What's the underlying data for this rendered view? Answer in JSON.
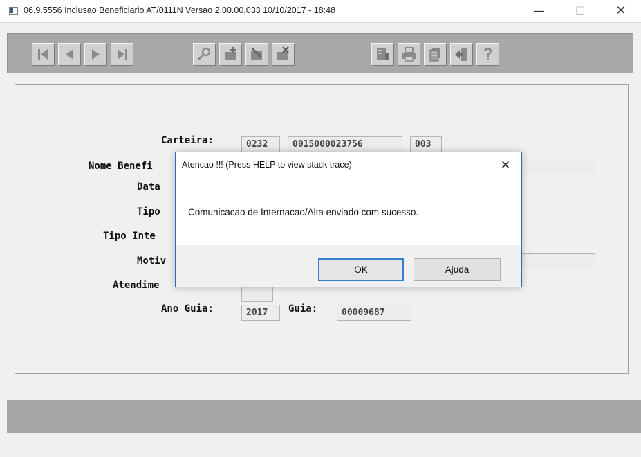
{
  "window": {
    "title": "06.9.5556  Inclusao  Beneficiario AT/0111N Versao 2.00.00.033 10/10/2017 - 18:48",
    "minimize_glyph": "—",
    "maximize_glyph": "☐",
    "close_glyph": "✕"
  },
  "toolbar": {
    "buttons": [
      {
        "name": "first-record-icon"
      },
      {
        "name": "previous-record-icon"
      },
      {
        "name": "next-record-icon"
      },
      {
        "name": "last-record-icon"
      },
      {
        "name": "search-icon"
      },
      {
        "name": "add-icon"
      },
      {
        "name": "edit-icon"
      },
      {
        "name": "delete-icon"
      },
      {
        "name": "filter-icon"
      },
      {
        "name": "print-icon"
      },
      {
        "name": "copy-icon"
      },
      {
        "name": "exit-icon"
      },
      {
        "name": "help-icon"
      }
    ]
  },
  "form": {
    "carteira_label": "Carteira:",
    "carteira_values": [
      "0232",
      "0015000023756",
      "003"
    ],
    "nome_label": "Nome Benefi",
    "data_label": "Data",
    "tipo_label": "Tipo",
    "tipo_inte_label": "Tipo Inte",
    "motiv_label": "Motiv",
    "atendime_label": "Atendime",
    "ano_guia_label": "Ano Guia:",
    "ano_guia_value": "2017",
    "guia_label": "Guia:",
    "guia_value": "00009687"
  },
  "dialog": {
    "title": "Atencao !!!  (Press HELP to view stack trace)",
    "message": "Comunicacao de Internacao/Alta enviado com sucesso.",
    "ok_label": "OK",
    "help_label": "Ajuda",
    "close_glyph": "✕"
  },
  "colors": {
    "toolbar_bg": "#a8a8a8",
    "dialog_border": "#2b6cb8",
    "ok_focus_border": "#2f80d2",
    "status_band": "#a6a6a6"
  }
}
